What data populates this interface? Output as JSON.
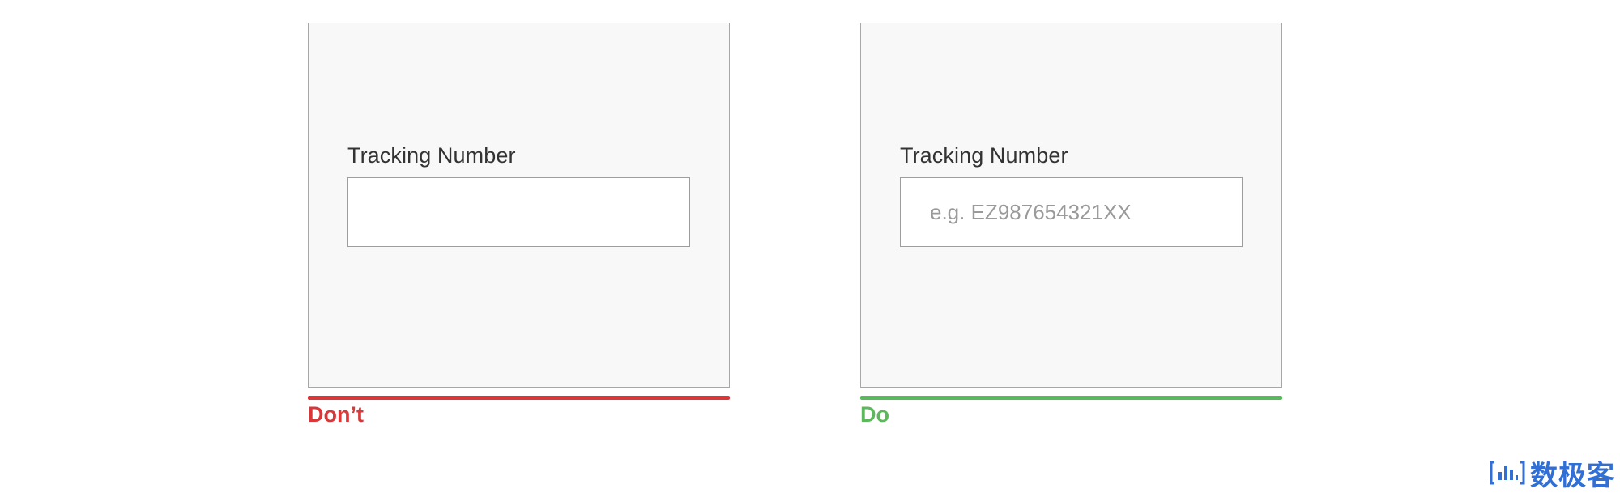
{
  "colors": {
    "dont": "#d9383a",
    "do": "#5cb85c",
    "brand": "#2f6fd6"
  },
  "dont_example": {
    "label": "Tracking Number",
    "input_value": "",
    "input_placeholder": "",
    "caption": "Don’t"
  },
  "do_example": {
    "label": "Tracking Number",
    "input_value": "",
    "input_placeholder": "e.g. EZ987654321XX",
    "caption": "Do"
  },
  "watermark": {
    "icon": "chart-bars-icon",
    "text": "数极客"
  }
}
